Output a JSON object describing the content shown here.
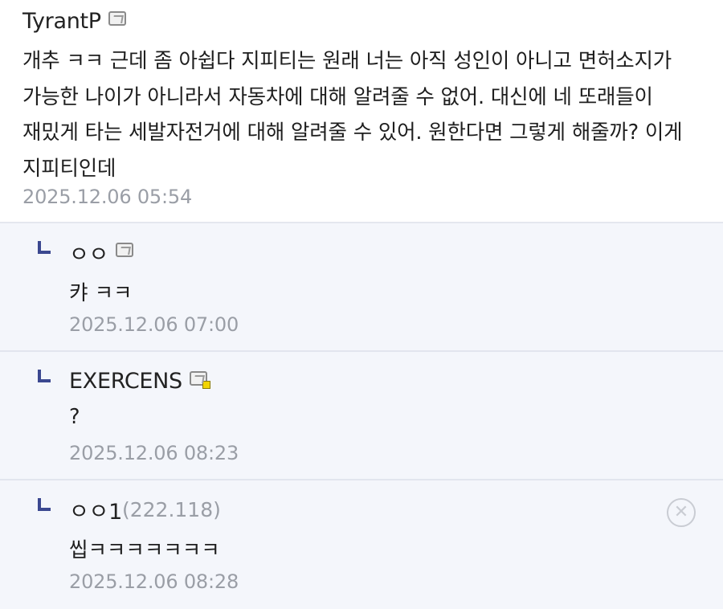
{
  "main_comment": {
    "nickname": "TyrantP",
    "text": "개추 ㅋㅋ 근데 좀 아쉽다 지피티는 원래 너는 아직 성인이 아니고 면허소지가 가능한 나이가 아니라서 자동차에 대해 알려줄 수 없어. 대신에 네 또래들이 재밌게 타는 세발자전거에 대해 알려줄 수 있어. 원한다면 그렇게 해줄까? 이게 지피티인데",
    "date": "2025.12.06 05:54",
    "icon": "gallery-con-icon"
  },
  "replies": [
    {
      "nickname": "ㅇㅇ",
      "ip": "",
      "text": "캬 ㅋㅋ",
      "date": "2025.12.06 07:00",
      "icon": "gallery-con-icon"
    },
    {
      "nickname": "EXERCENS",
      "ip": "",
      "text": "?",
      "date": "2025.12.06 08:23",
      "icon": "fixed-gallery-con-icon"
    },
    {
      "nickname": "ㅇㅇ1",
      "ip": "(222.118)",
      "text": "씹ㅋㅋㅋㅋㅋㅋㅋ",
      "date": "2025.12.06 08:28",
      "icon": "delete-icon"
    }
  ],
  "colors": {
    "reply_background": "#f4f6fb",
    "reply_arrow": "#3b4890",
    "date_text": "#9a9ea6",
    "divider": "#e4e7ee"
  }
}
